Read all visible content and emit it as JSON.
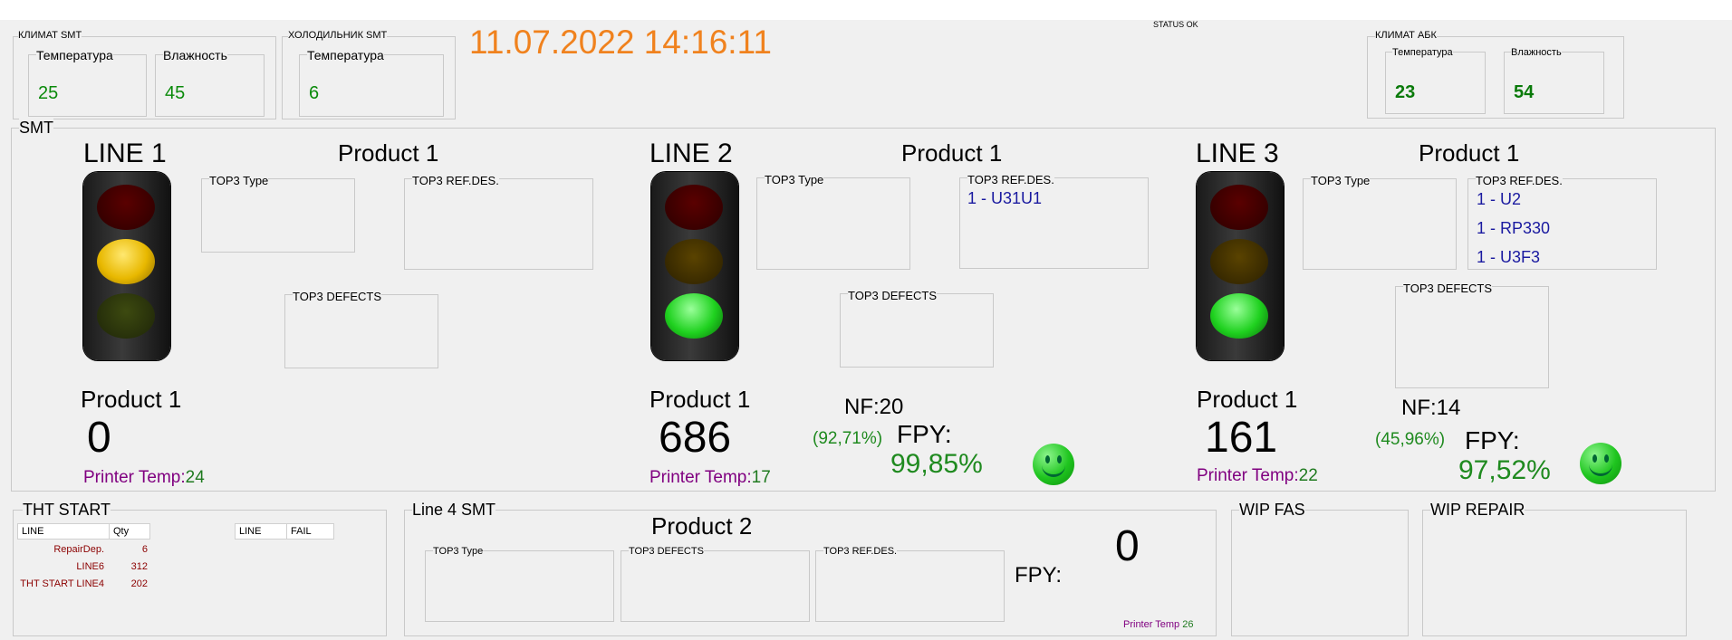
{
  "header": {
    "datetime": "11.07.2022 14:16:11",
    "status": "STATUS OK",
    "colors": {
      "datetime": "#f0821e",
      "ok_green": "#1f8a1f",
      "printer": "#800080",
      "blue_ref": "#1a1aa0"
    }
  },
  "climate_smt": {
    "title": "КЛИМАТ SMT",
    "temp_label": "Температура",
    "temp_value": "25",
    "hum_label": "Влажность",
    "hum_value": "45"
  },
  "fridge_smt": {
    "title": "ХОЛОДИЛЬНИК SMT",
    "temp_label": "Температура",
    "temp_value": "6"
  },
  "climate_abk": {
    "title": "КЛИМАТ АБК",
    "temp_label": "Температура",
    "temp_value": "23",
    "hum_label": "Влажность",
    "hum_value": "54"
  },
  "smt": {
    "title": "SMT",
    "lines": [
      {
        "name": "LINE 1",
        "product_header": "Product 1",
        "top3_type": "TOP3 Type",
        "top3_ref": "TOP3 REF.DES.",
        "top3_defects": "TOP3 DEFECTS",
        "ref_items": [],
        "light_state": "yellow",
        "product_label": "Product 1",
        "count": "0",
        "printer_label": "Printer Temp:",
        "printer_value": "24"
      },
      {
        "name": "LINE 2",
        "product_header": "Product 1",
        "top3_type": "TOP3 Type",
        "top3_ref": "TOP3 REF.DES.",
        "top3_defects": "TOP3 DEFECTS",
        "ref_items": [
          "1 - U31U1"
        ],
        "light_state": "green",
        "product_label": "Product 1",
        "count": "686",
        "printer_label": "Printer Temp:",
        "printer_value": "17",
        "nf": "NF:20",
        "nf_pct": "(92,71%)",
        "fpy_label": "FPY:",
        "fpy_value": "99,85%",
        "status_icon": "smiley-icon"
      },
      {
        "name": "LINE 3",
        "product_header": "Product 1",
        "top3_type": "TOP3 Type",
        "top3_ref": "TOP3 REF.DES.",
        "top3_defects": "TOP3 DEFECTS",
        "ref_items": [
          "1 - U2",
          "1 - RP330",
          "1 - U3F3"
        ],
        "light_state": "green",
        "product_label": "Product 1",
        "count": "161",
        "printer_label": "Printer Temp:",
        "printer_value": "22",
        "nf": "NF:14",
        "nf_pct": "(45,96%)",
        "fpy_label": "FPY:",
        "fpy_value": "97,52%",
        "status_icon": "smiley-icon"
      }
    ]
  },
  "tht_start": {
    "title": "THT START",
    "headers": [
      "LINE",
      "Qty"
    ],
    "rows": [
      {
        "line": "RepairDep.",
        "qty": "6"
      },
      {
        "line": "LINE6",
        "qty": "312"
      },
      {
        "line": "THT START LINE4",
        "qty": "202"
      }
    ],
    "fail_headers": [
      "LINE",
      "FAIL"
    ]
  },
  "line4": {
    "title": "Line 4 SMT",
    "product_header": "Product 2",
    "top3_type": "TOP3 Type",
    "top3_defects": "TOP3 DEFECTS",
    "top3_ref": "TOP3 REF.DES.",
    "fpy_label": "FPY:",
    "count": "0",
    "printer_label": "Printer Temp",
    "printer_value": "26"
  },
  "wip_fas": {
    "title": "WIP FAS"
  },
  "wip_repair": {
    "title": "WIP REPAIR"
  }
}
